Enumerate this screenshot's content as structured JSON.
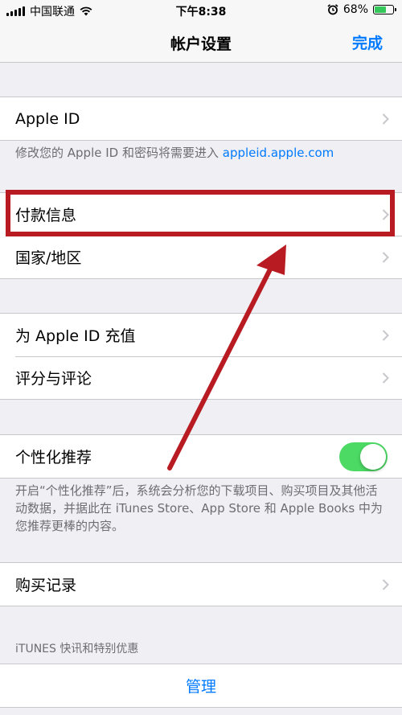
{
  "status_bar": {
    "carrier": "中国联通",
    "time": "下午8:38",
    "battery_percent": "68%",
    "battery_level": 0.68,
    "icons": [
      "signal-icon",
      "wifi-icon",
      "alarm-icon",
      "battery-icon"
    ]
  },
  "nav": {
    "title": "帐户设置",
    "done_label": "完成"
  },
  "group1": {
    "apple_id_label": "Apple ID",
    "footnote_text": "修改您的 Apple ID 和密码将需要进入 ",
    "footnote_link": "appleid.apple.com"
  },
  "group2": {
    "payment_label": "付款信息",
    "region_label": "国家/地区"
  },
  "group3": {
    "topup_label": "为 Apple ID 充值",
    "ratings_label": "评分与评论"
  },
  "group4": {
    "personalized_label": "个性化推荐",
    "personalized_on": true,
    "footnote": "开启“个性化推荐”后，系统会分析您的下载项目、购买项目及其他活动数据，并据此在 iTunes Store、App Store 和 Apple Books 中为您推荐更棒的内容。"
  },
  "group5": {
    "purchase_history_label": "购买记录"
  },
  "itunes_section": {
    "header": "iTUNES 快讯和特别优惠",
    "manage_label": "管理"
  },
  "colors": {
    "accent": "#007aff",
    "toggle_on": "#4cd964",
    "annotation": "#b81c22"
  }
}
